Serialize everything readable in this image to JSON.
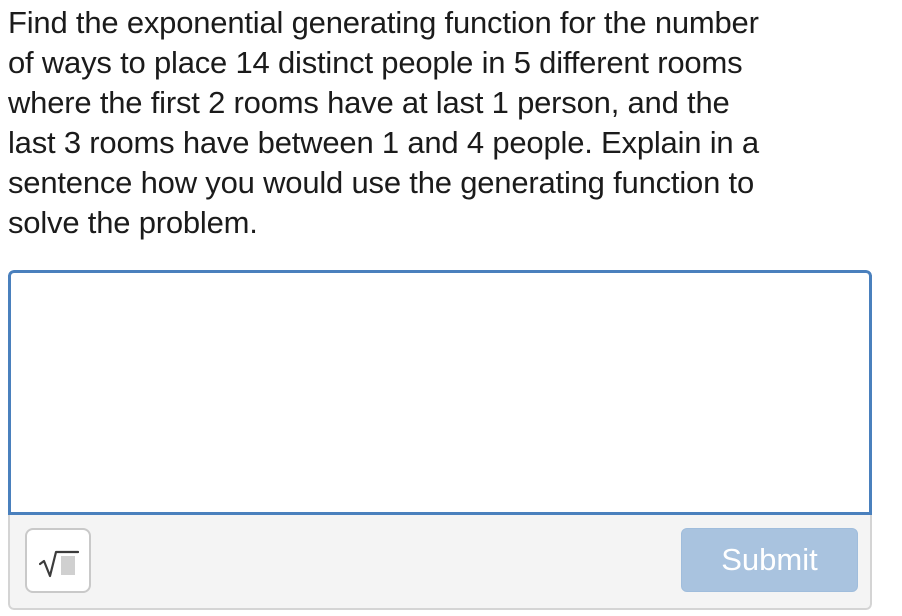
{
  "question": {
    "text": "Find the exponential generating function for the number\nof ways to place 14 distinct people in 5 different rooms\nwhere the first 2 rooms have at last 1 person, and the\nlast 3 rooms have between 1 and 4 people. Explain in a\nsentence how you would use the generating function to\nsolve the problem."
  },
  "answer": {
    "value": ""
  },
  "toolbar": {
    "math_icon": "square-root-icon",
    "submit_label": "Submit"
  },
  "colors": {
    "input_border": "#4a80bd",
    "submit_background": "#a9c3df",
    "toolbar_background": "#f4f4f4"
  }
}
